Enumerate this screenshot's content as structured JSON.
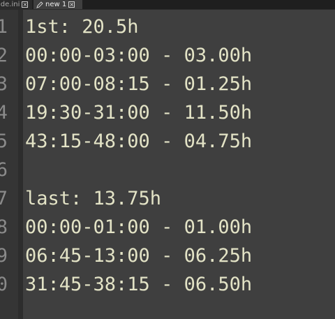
{
  "tabs": [
    {
      "label": "ide.ini",
      "active": false
    },
    {
      "label": "new 1",
      "active": true
    }
  ],
  "gutter": {
    "line_numbers": [
      "1",
      "2",
      "3",
      "4",
      "5",
      "6",
      "7",
      "8",
      "9",
      "0"
    ]
  },
  "editor": {
    "lines": [
      "1st: 20.5h",
      "00:00-03:00 - 03.00h",
      "07:00-08:15 - 01.25h",
      "19:30-31:00 - 11.50h",
      "43:15-48:00 - 04.75h",
      "",
      "last: 13.75h",
      "00:00-01:00 - 01.00h",
      "06:45-13:00 - 06.25h",
      "31:45-38:15 - 06.50h"
    ]
  },
  "colors": {
    "editor_bg": "#3f3f3f",
    "gutter_bg": "#353535",
    "text": "#e3e3c6",
    "line_number": "#8a8a8a"
  },
  "icons": {
    "tab_modified": "pencil-icon",
    "tab_close": "close-icon"
  }
}
